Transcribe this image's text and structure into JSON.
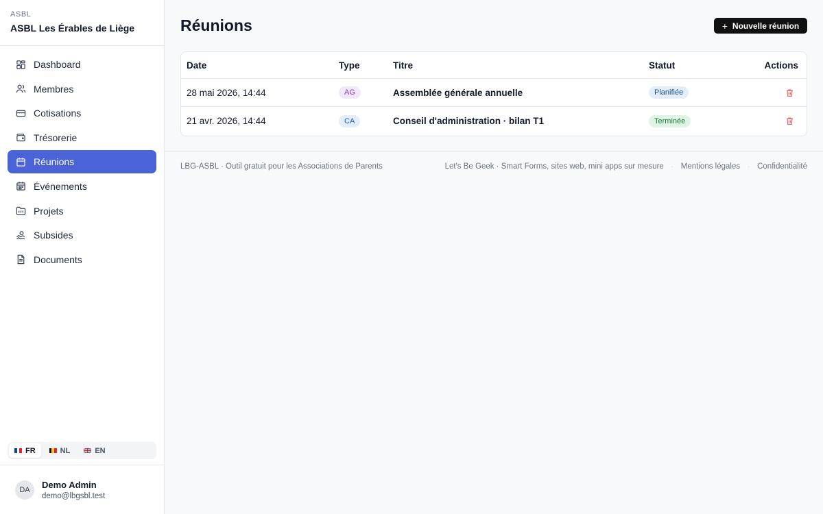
{
  "sidebar": {
    "org_kind": "ASBL",
    "org_name": "ASBL Les Érables de Liège",
    "items": [
      {
        "label": "Dashboard",
        "icon": "dashboard-icon"
      },
      {
        "label": "Membres",
        "icon": "users-icon"
      },
      {
        "label": "Cotisations",
        "icon": "credit-card-icon"
      },
      {
        "label": "Trésorerie",
        "icon": "wallet-icon"
      },
      {
        "label": "Réunions",
        "icon": "calendar-icon",
        "active": true
      },
      {
        "label": "Événements",
        "icon": "calendar-days-icon"
      },
      {
        "label": "Projets",
        "icon": "folder-icon"
      },
      {
        "label": "Subsides",
        "icon": "hand-coins-icon"
      },
      {
        "label": "Documents",
        "icon": "document-icon"
      }
    ],
    "languages": [
      {
        "code": "FR",
        "active": true
      },
      {
        "code": "NL",
        "active": false
      },
      {
        "code": "EN",
        "active": false
      }
    ],
    "user": {
      "initials": "DA",
      "name": "Demo Admin",
      "email": "demo@lbgsbl.test"
    }
  },
  "main": {
    "title": "Réunions",
    "new_button": "Nouvelle réunion",
    "columns": {
      "date": "Date",
      "type": "Type",
      "title": "Titre",
      "status": "Statut",
      "actions": "Actions"
    },
    "rows": [
      {
        "date": "28 mai 2026, 14:44",
        "type": "AG",
        "title": "Assemblée générale annuelle",
        "status": "Planifiée"
      },
      {
        "date": "21 avr. 2026, 14:44",
        "type": "CA",
        "title": "Conseil d'administration · bilan T1",
        "status": "Terminée"
      }
    ]
  },
  "footer": {
    "left": "LBG-ASBL · Outil gratuit pour les Associations de Parents",
    "credit": "Let's Be Geek · Smart Forms, sites web, mini apps sur mesure",
    "legal": "Mentions légales",
    "privacy": "Confidentialité",
    "separator": "·"
  },
  "colors": {
    "accent": "#4a63d6",
    "button": "#111111",
    "danger": "#ef6262"
  }
}
